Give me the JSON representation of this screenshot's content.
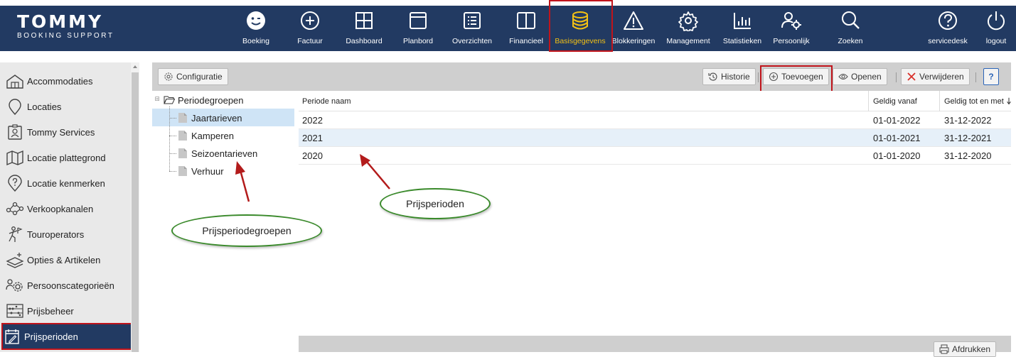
{
  "logo": {
    "name": "TOMMY",
    "sub": "BOOKING SUPPORT"
  },
  "nav": [
    {
      "label": "Boeking",
      "icon": "smiley-icon"
    },
    {
      "label": "Factuur",
      "icon": "plus-circle-icon"
    },
    {
      "label": "Dashboard",
      "icon": "dashboard-grid-icon"
    },
    {
      "label": "Planbord",
      "icon": "planbord-window-icon"
    },
    {
      "label": "Overzichten",
      "icon": "list-icon"
    },
    {
      "label": "Financieel",
      "icon": "columns-icon"
    },
    {
      "label": "Basisgegevens",
      "icon": "database-icon",
      "active": true
    },
    {
      "label": "Blokkeringen",
      "icon": "warning-triangle-icon"
    },
    {
      "label": "Management",
      "icon": "gear-icon"
    },
    {
      "label": "Statistieken",
      "icon": "bar-chart-icon"
    },
    {
      "label": "Persoonlijk",
      "icon": "user-settings-icon"
    },
    {
      "label": "Zoeken",
      "icon": "search-icon"
    },
    {
      "label": "servicedesk",
      "icon": "help-circle-icon"
    },
    {
      "label": "logout",
      "icon": "power-icon"
    }
  ],
  "sidebar": {
    "items": [
      {
        "label": "Accommodaties",
        "icon": "house-icon"
      },
      {
        "label": "Locaties",
        "icon": "map-pin-icon"
      },
      {
        "label": "Tommy Services",
        "icon": "id-badge-icon"
      },
      {
        "label": "Locatie plattegrond",
        "icon": "map-icon"
      },
      {
        "label": "Locatie kenmerken",
        "icon": "question-pin-icon"
      },
      {
        "label": "Verkoopkanalen",
        "icon": "network-icon"
      },
      {
        "label": "Touroperators",
        "icon": "tour-icon"
      },
      {
        "label": "Opties & Artikelen",
        "icon": "options-icon"
      },
      {
        "label": "Persoonscategorieën",
        "icon": "people-gear-icon"
      },
      {
        "label": "Prijsbeheer",
        "icon": "abacus-icon"
      },
      {
        "label": "Prijsperioden",
        "icon": "calendar-edit-icon",
        "active": true
      }
    ]
  },
  "toolbar": {
    "configuratie": "Configuratie",
    "historie": "Historie",
    "toevoegen": "Toevoegen",
    "openen": "Openen",
    "verwijderen": "Verwijderen",
    "help": "?"
  },
  "tree": {
    "root": "Periodegroepen",
    "children": [
      "Jaartarieven",
      "Kamperen",
      "Seizoentarieven",
      "Verhuur"
    ],
    "selected": "Jaartarieven"
  },
  "table": {
    "columns": [
      "Periode naam",
      "Geldig vanaf",
      "Geldig tot en met"
    ],
    "rows": [
      {
        "naam": "2022",
        "vanaf": "01-01-2022",
        "tot": "31-12-2022"
      },
      {
        "naam": "2021",
        "vanaf": "01-01-2021",
        "tot": "31-12-2021"
      },
      {
        "naam": "2020",
        "vanaf": "01-01-2020",
        "tot": "31-12-2020"
      }
    ]
  },
  "footer": {
    "print": "Afdrukken"
  },
  "annotations": {
    "groups": "Prijsperiodegroepen",
    "periods": "Prijsperioden"
  },
  "colors": {
    "nav_bg": "#223a62",
    "active_nav": "#f3c114",
    "highlight_box": "#c0141b",
    "annotation_ellipse": "#3a8a2b",
    "selection": "#cfe4f6"
  }
}
